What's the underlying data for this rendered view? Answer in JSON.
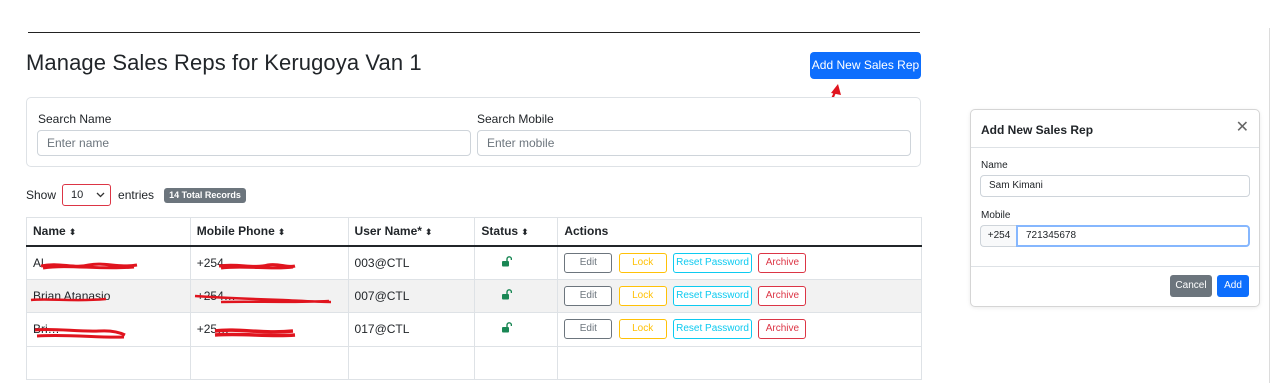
{
  "page": {
    "title": "Manage Sales Reps for Kerugoya Van 1",
    "add_button": "Add New Sales Rep"
  },
  "filters": {
    "name_label": "Search Name",
    "name_placeholder": "Enter name",
    "mobile_label": "Search Mobile",
    "mobile_placeholder": "Enter mobile"
  },
  "pagination": {
    "show_label": "Show",
    "page_size": "10",
    "entries_label": "entries",
    "records_badge": "14 Total Records"
  },
  "table": {
    "headers": [
      "Name",
      "Mobile Phone",
      "User Name*",
      "Status",
      "Actions"
    ],
    "action_labels": {
      "edit": "Edit",
      "lock": "Lock",
      "reset": "Reset Password",
      "archive": "Archive"
    },
    "rows": [
      {
        "name": "Al…",
        "mobile": "+254…",
        "username": "003@CTL",
        "status": "unlocked"
      },
      {
        "name": "Brian Atanasio",
        "mobile": "+254…",
        "username": "007@CTL",
        "status": "unlocked"
      },
      {
        "name": "Bri…",
        "mobile": "+25…",
        "username": "017@CTL",
        "status": "unlocked"
      }
    ]
  },
  "modal": {
    "title": "Add New Sales Rep",
    "name_label": "Name",
    "name_value": "Sam Kimani",
    "mobile_label": "Mobile",
    "mobile_prefix": "+254",
    "mobile_value": "721345678",
    "cancel": "Cancel",
    "add": "Add"
  },
  "colors": {
    "primary": "#0d6efd",
    "annotation_arrow": "#e0141e",
    "redaction": "#e0141e",
    "status_unlocked": "#198754"
  }
}
